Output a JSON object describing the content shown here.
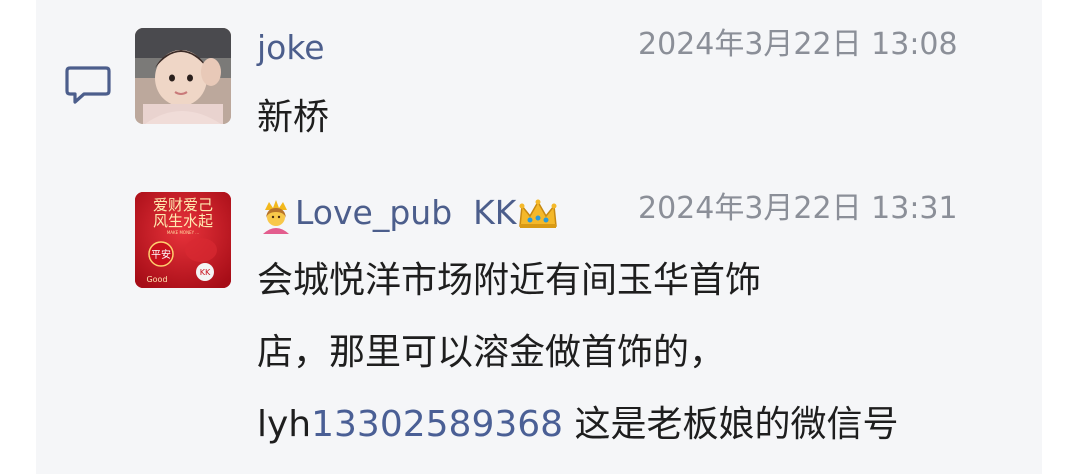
{
  "icons": {
    "comment": "comment-bubble-icon",
    "crown": "crown-icon",
    "person": "person-emoji-icon"
  },
  "colors": {
    "username": "#4c5e8c",
    "timestamp": "#8b8f98",
    "link": "#4a5f95",
    "panel_bg": "#f5f6f8"
  },
  "comments": [
    {
      "author": "joke",
      "timestamp": "2024年3月22日 13:08",
      "lines": [
        "新桥"
      ]
    },
    {
      "author": "Love_pub  KK",
      "timestamp": "2024年3月22日 13:31",
      "lines": [
        "会城悦洋市场附近有间玉华首饰",
        "店，那里可以溶金做首饰的，"
      ],
      "last_line": {
        "prefix": "lyh",
        "phone": "13302589368",
        "suffix": " 这是老板娘的微信号"
      },
      "avatar_text": {
        "top": "爱财爱己",
        "middle": "风生水起",
        "small": "MAKE MONEY ...",
        "badge": "平安",
        "good": "Good",
        "kk": "KK"
      }
    }
  ]
}
